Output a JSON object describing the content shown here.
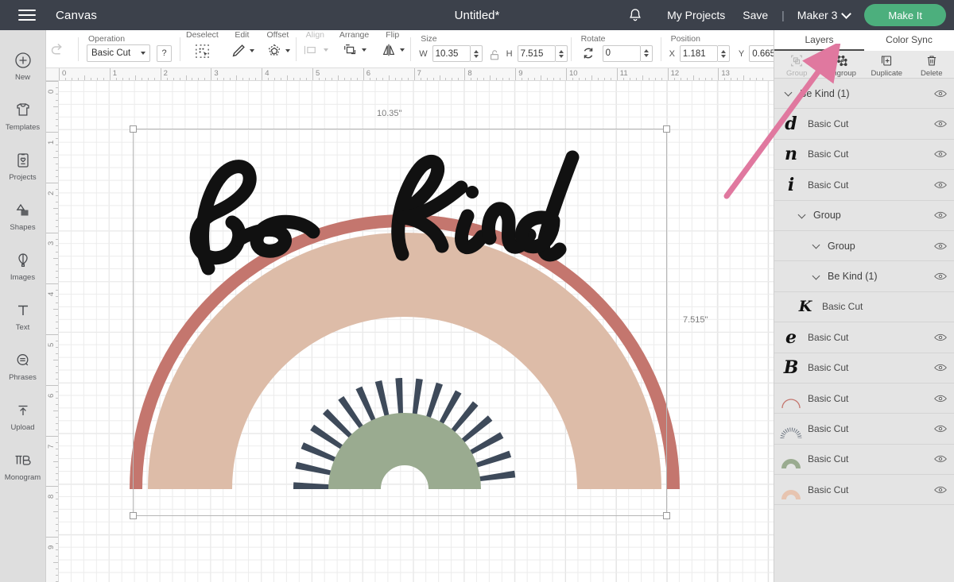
{
  "topbar": {
    "menu_icon": "hamburger-icon",
    "canvas_label": "Canvas",
    "document_title": "Untitled*",
    "notification_icon": "bell-icon",
    "my_projects": "My Projects",
    "save": "Save",
    "separator": "|",
    "machine": "Maker 3",
    "machine_chevron": "chevron-down-icon",
    "make_it": "Make It"
  },
  "toolbar": {
    "undo_icon": "undo-icon",
    "redo_icon": "redo-icon",
    "operation_label": "Operation",
    "operation_value": "Basic Cut",
    "help_label": "?",
    "deselect_label": "Deselect",
    "edit_label": "Edit",
    "offset_label": "Offset",
    "align_label": "Align",
    "arrange_label": "Arrange",
    "flip_label": "Flip",
    "size_label": "Size",
    "width_label": "W",
    "width_value": "10.35",
    "lock_icon": "unlock-icon",
    "height_label": "H",
    "height_value": "7.515",
    "rotate_label": "Rotate",
    "rotate_value": "0",
    "position_label": "Position",
    "x_label": "X",
    "x_value": "1.181",
    "y_label": "Y",
    "y_value": "0.665"
  },
  "sidebar": {
    "items": [
      {
        "label": "New",
        "icon": "plus-circle-icon"
      },
      {
        "label": "Templates",
        "icon": "tshirt-icon"
      },
      {
        "label": "Projects",
        "icon": "projects-heart-icon"
      },
      {
        "label": "Shapes",
        "icon": "shapes-icon"
      },
      {
        "label": "Images",
        "icon": "balloon-icon"
      },
      {
        "label": "Text",
        "icon": "text-t-icon"
      },
      {
        "label": "Phrases",
        "icon": "phrases-bubble-icon"
      },
      {
        "label": "Upload",
        "icon": "upload-arrow-icon"
      },
      {
        "label": "Monogram",
        "icon": "monogram-icon"
      }
    ]
  },
  "canvas": {
    "ruler_h_ticks": [
      "0",
      "1",
      "2",
      "3",
      "4",
      "5",
      "6",
      "7",
      "8",
      "9",
      "10",
      "11",
      "12",
      "13"
    ],
    "ruler_v_ticks": [
      "0",
      "1",
      "2",
      "3",
      "4",
      "5",
      "6",
      "7",
      "8",
      "9"
    ],
    "width_dimension": "10.35\"",
    "height_dimension": "7.515\"",
    "artwork_name": "be-kind-rainbow",
    "colors": {
      "coral": "#c4766e",
      "tan": "#ddbca8",
      "sage": "#9aab90",
      "slate": "#3e4a5a",
      "black": "#111111",
      "white": "#ffffff"
    }
  },
  "annotation": {
    "arrow_color": "#e0789f",
    "points_to": "Ungroup"
  },
  "right_panel": {
    "tabs": [
      {
        "label": "Layers",
        "active": true
      },
      {
        "label": "Color Sync",
        "active": false
      }
    ],
    "tools": [
      {
        "label": "Group",
        "icon": "group-icon",
        "disabled": true
      },
      {
        "label": "Ungroup",
        "icon": "ungroup-icon",
        "disabled": false
      },
      {
        "label": "Duplicate",
        "icon": "duplicate-icon",
        "disabled": false
      },
      {
        "label": "Delete",
        "icon": "trash-icon",
        "disabled": false
      }
    ],
    "layers": [
      {
        "type": "group",
        "label": "Be Kind (1)",
        "indent": 0,
        "chevron": true,
        "eye": true
      },
      {
        "type": "layer",
        "label": "Basic Cut",
        "glyph": "d",
        "indent": 0,
        "eye": true
      },
      {
        "type": "layer",
        "label": "Basic Cut",
        "glyph": "n",
        "indent": 0,
        "eye": true
      },
      {
        "type": "layer",
        "label": "Basic Cut",
        "glyph": "i",
        "indent": 0,
        "eye": true
      },
      {
        "type": "group",
        "label": "Group",
        "indent": 1,
        "chevron": true,
        "eye": true
      },
      {
        "type": "group",
        "label": "Group",
        "indent": 2,
        "chevron": true,
        "eye": true
      },
      {
        "type": "group",
        "label": "Be Kind (1)",
        "indent": 3,
        "chevron": true,
        "eye": true
      },
      {
        "type": "layer",
        "label": "Basic Cut",
        "glyph": "K",
        "indent": 2,
        "eye": false
      },
      {
        "type": "layer",
        "label": "Basic Cut",
        "glyph": "e",
        "indent": 0,
        "eye": true
      },
      {
        "type": "layer",
        "label": "Basic Cut",
        "glyph": "B",
        "indent": 0,
        "eye": true
      },
      {
        "type": "layer",
        "label": "Basic Cut",
        "shape": "arch-outline-coral",
        "indent": 0,
        "eye": true
      },
      {
        "type": "layer",
        "label": "Basic Cut",
        "shape": "arch-dashes-slate",
        "indent": 0,
        "eye": true
      },
      {
        "type": "layer",
        "label": "Basic Cut",
        "shape": "arch-solid-sage",
        "indent": 0,
        "eye": true
      },
      {
        "type": "layer",
        "label": "Basic Cut",
        "shape": "arch-solid-tan",
        "indent": 0,
        "eye": true
      }
    ]
  }
}
